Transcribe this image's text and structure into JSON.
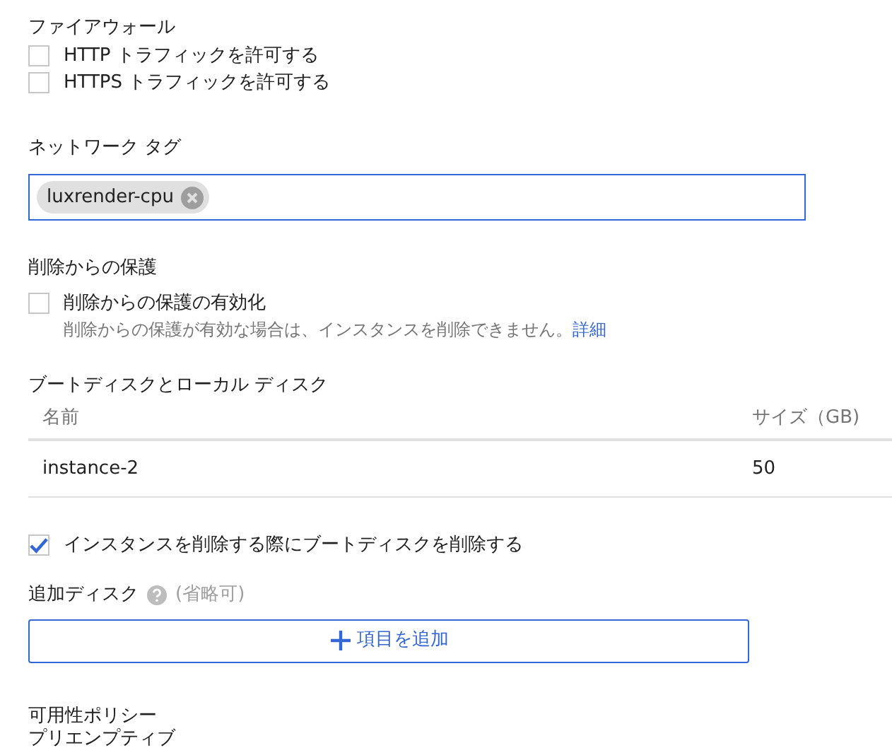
{
  "firewall": {
    "label": "ファイアウォール",
    "options": [
      {
        "label": "HTTP トラフィックを許可する",
        "checked": false
      },
      {
        "label": "HTTPS トラフィックを許可する",
        "checked": false
      }
    ]
  },
  "network_tags": {
    "label": "ネットワーク タグ",
    "tags": [
      "luxrender-cpu"
    ]
  },
  "deletion_protection": {
    "label": "削除からの保護",
    "option": {
      "label": "削除からの保護の有効化",
      "checked": false
    },
    "help": "削除からの保護が有効な場合は、インスタンスを削除できません。",
    "link": "詳細"
  },
  "boot_disks": {
    "label": "ブートディスクとローカル ディスク",
    "columns": [
      "名前",
      "サイズ（GB)"
    ],
    "rows": [
      [
        "instance-2",
        "50"
      ]
    ]
  },
  "delete_boot_disk": {
    "label": "インスタンスを削除する際にブートディスクを削除する",
    "checked": true
  },
  "additional_disks": {
    "label": "追加ディスク",
    "optional": "(省略可)",
    "button": "項目を追加"
  },
  "availability_policy": {
    "label": "可用性ポリシー",
    "value": "プリエンプティブ"
  }
}
